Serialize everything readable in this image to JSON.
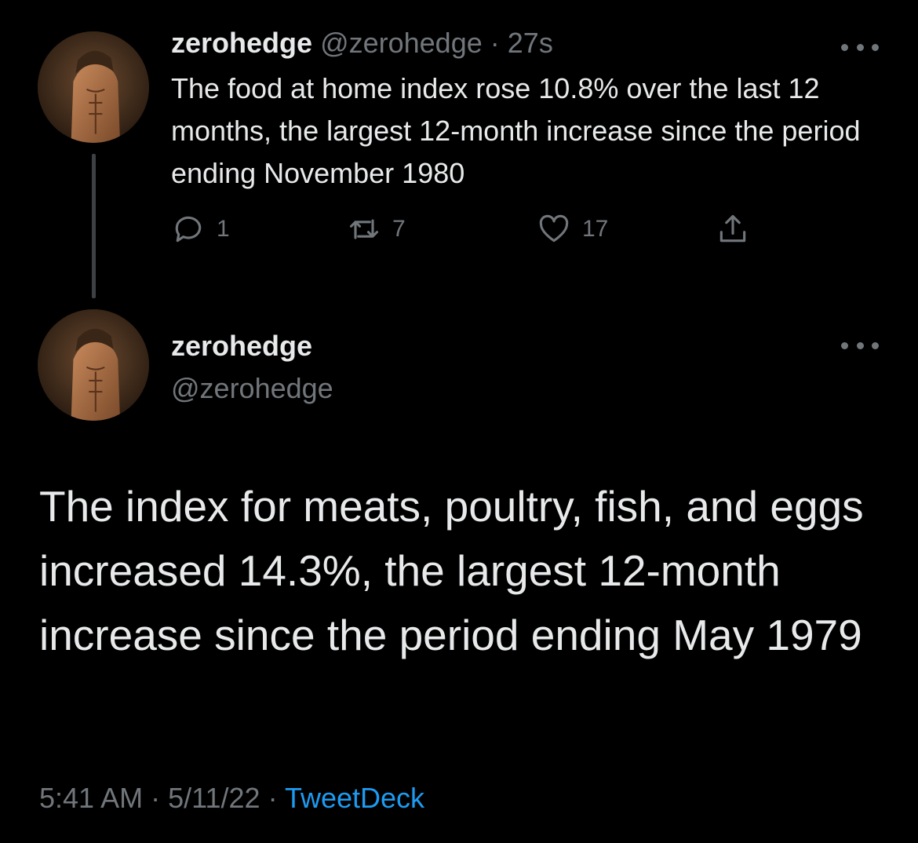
{
  "tweet1": {
    "name": "zerohedge",
    "handle": "@zerohedge",
    "separator": "·",
    "time": "27s",
    "text": "The food at home index rose 10.8% over the last 12 months, the largest 12-month increase since the period ending November 1980",
    "replies": "1",
    "retweets": "7",
    "likes": "17"
  },
  "tweet2": {
    "name": "zerohedge",
    "handle": "@zerohedge",
    "text": "The index for meats, poultry, fish, and eggs increased 14.3%, the largest 12-month increase since the period ending May 1979",
    "time": "5:41 AM",
    "separator1": "·",
    "date": "5/11/22",
    "separator2": "·",
    "source": "TweetDeck"
  },
  "icons": {
    "reply": "reply-icon",
    "retweet": "retweet-icon",
    "like": "heart-icon",
    "share": "share-icon",
    "more": "more-icon"
  },
  "colors": {
    "background": "#000000",
    "text": "#e7e9ea",
    "muted": "#71767b",
    "link": "#1d9bf0"
  }
}
